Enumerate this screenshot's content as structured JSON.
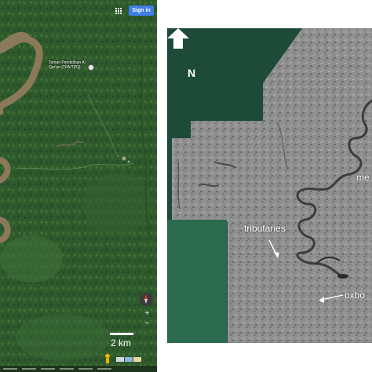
{
  "map": {
    "signin_label": "Sign in",
    "apps_icon": "apps-grid-icon",
    "place_label": "Taman Pendidikan Al Qur'an (TPA/TPQ)",
    "scale_label": "2 km",
    "compass_icon": "compass-icon",
    "zoom_controls": [
      "+",
      "−"
    ]
  },
  "radar": {
    "north_label": "N",
    "annotations": {
      "meander": "me",
      "tributaries": "tributaries",
      "oxbow": "oxbo"
    }
  },
  "colors": {
    "forest": "#2f5a2c",
    "river": "#8a7a5a",
    "signin": "#3f7ee8",
    "radar_frame": "#1e4a38",
    "radar_inset": "#2b6a4e"
  }
}
